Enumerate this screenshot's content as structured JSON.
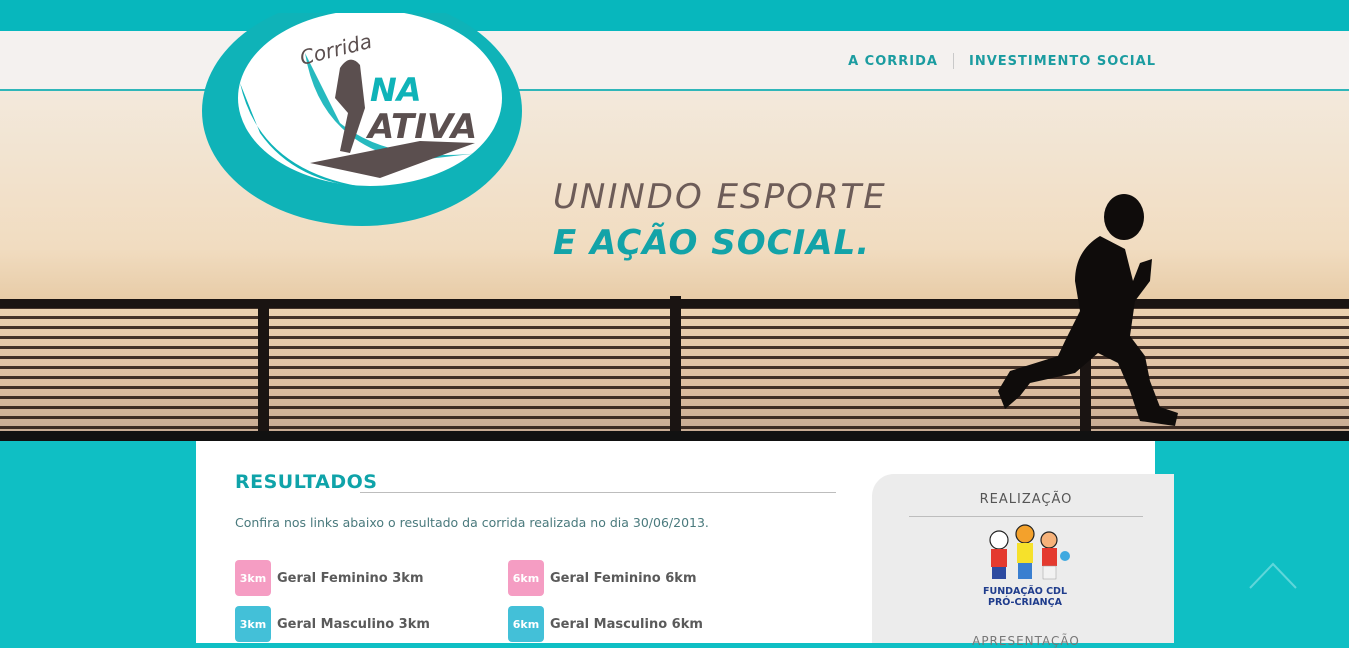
{
  "header": {
    "nav": [
      {
        "label": "A CORRIDA"
      },
      {
        "label": "INVESTIMENTO SOCIAL"
      }
    ]
  },
  "logo": {
    "line1": "Corrida",
    "line2": "NA",
    "line3": "ATIVA"
  },
  "hero": {
    "slogan_line1": "UNINDO ESPORTE",
    "slogan_line2": "E AÇÃO SOCIAL."
  },
  "results": {
    "title": "RESULTADOS",
    "intro": "Confira nos links abaixo o resultado da corrida realizada no dia 30/06/2013.",
    "items": [
      {
        "badge": "3km",
        "label": "Geral Feminino 3km",
        "color": "#f59dc3"
      },
      {
        "badge": "6km",
        "label": "Geral Feminino 6km",
        "color": "#f59dc3"
      },
      {
        "badge": "3km",
        "label": "Geral Masculino 3km",
        "color": "#43c0d8"
      },
      {
        "badge": "6km",
        "label": "Geral Masculino 6km",
        "color": "#43c0d8"
      }
    ]
  },
  "sidebar": {
    "title": "REALIZAÇÃO",
    "partner_logo_text1": "FUNDAÇÃO CDL",
    "partner_logo_text2": "PRÓ-CRIANÇA",
    "next_heading": "APRESENTAÇÃO"
  },
  "colors": {
    "accent": "#0fa3a9",
    "teal_band": "#07b7bd",
    "slogan_gray": "#6d5c58"
  }
}
